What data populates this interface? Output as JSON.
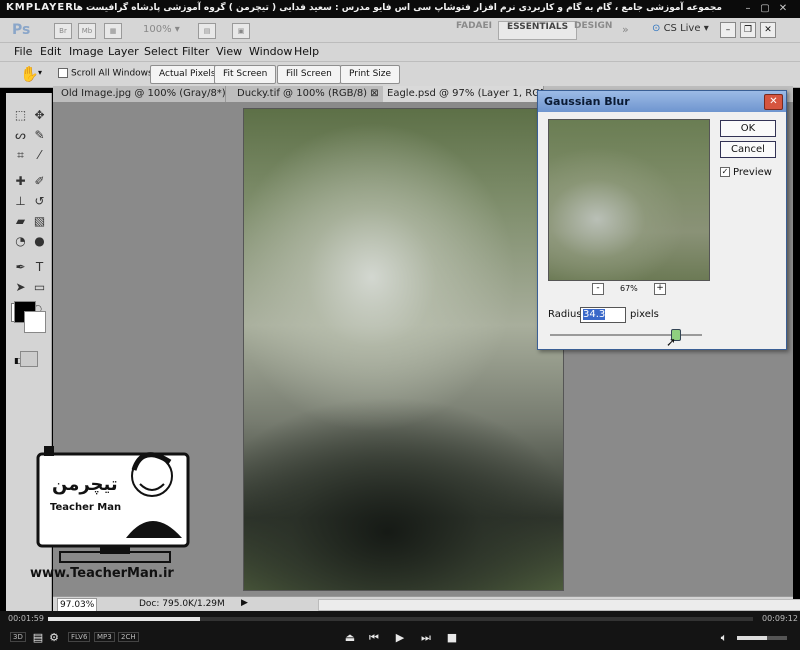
{
  "player": {
    "logo": "KMPLAYER",
    "title": "مجموعه آموزشی جامع ، گام به گام و کاربردی نرم افزار فتوشاپ سی اس فایو  مدرس : سعید فدایی ( تیچرمن ) گروه آموزشی پادشاه گرافیست ها",
    "time_current": "00:01:59",
    "time_total": "00:09:12",
    "progress": 0.216,
    "volume": 0.6,
    "tags": [
      "3D",
      "FLV6",
      "MP3",
      "2CH"
    ]
  },
  "ps": {
    "logo": "Ps",
    "zoom_dropdown": "100%",
    "workspaces": [
      "FADAEI",
      "ESSENTIALS",
      "DESIGN"
    ],
    "cslive": "CS Live"
  },
  "menu": [
    "File",
    "Edit",
    "Image",
    "Layer",
    "Select",
    "Filter",
    "View",
    "Window",
    "Help"
  ],
  "options": {
    "scroll_all": "Scroll All Windows",
    "buttons": [
      "Actual Pixels",
      "Fit Screen",
      "Fill Screen",
      "Print Size"
    ]
  },
  "tabs": [
    "Old Image.jpg @ 100% (Gray/8*) *",
    "Ducky.tif @ 100% (RGB/8)",
    "Eagle.psd @ 97% (Layer 1, RGB/8"
  ],
  "status": {
    "zoom": "97.03%",
    "doc": "Doc: 795.0K/1.29M"
  },
  "dialog": {
    "title": "Gaussian Blur",
    "ok": "OK",
    "cancel": "Cancel",
    "preview_label": "Preview",
    "preview_checked": true,
    "zoom_minus": "-",
    "zoom_plus": "+",
    "zoom": "67%",
    "radius_label": "Radius:",
    "radius_value": "34.3",
    "unit": "pixels",
    "slider_level": 0.82
  },
  "watermark": {
    "persian": "تیچرمن",
    "english": "Teacher Man",
    "url": "www.TeacherMan.ir"
  }
}
